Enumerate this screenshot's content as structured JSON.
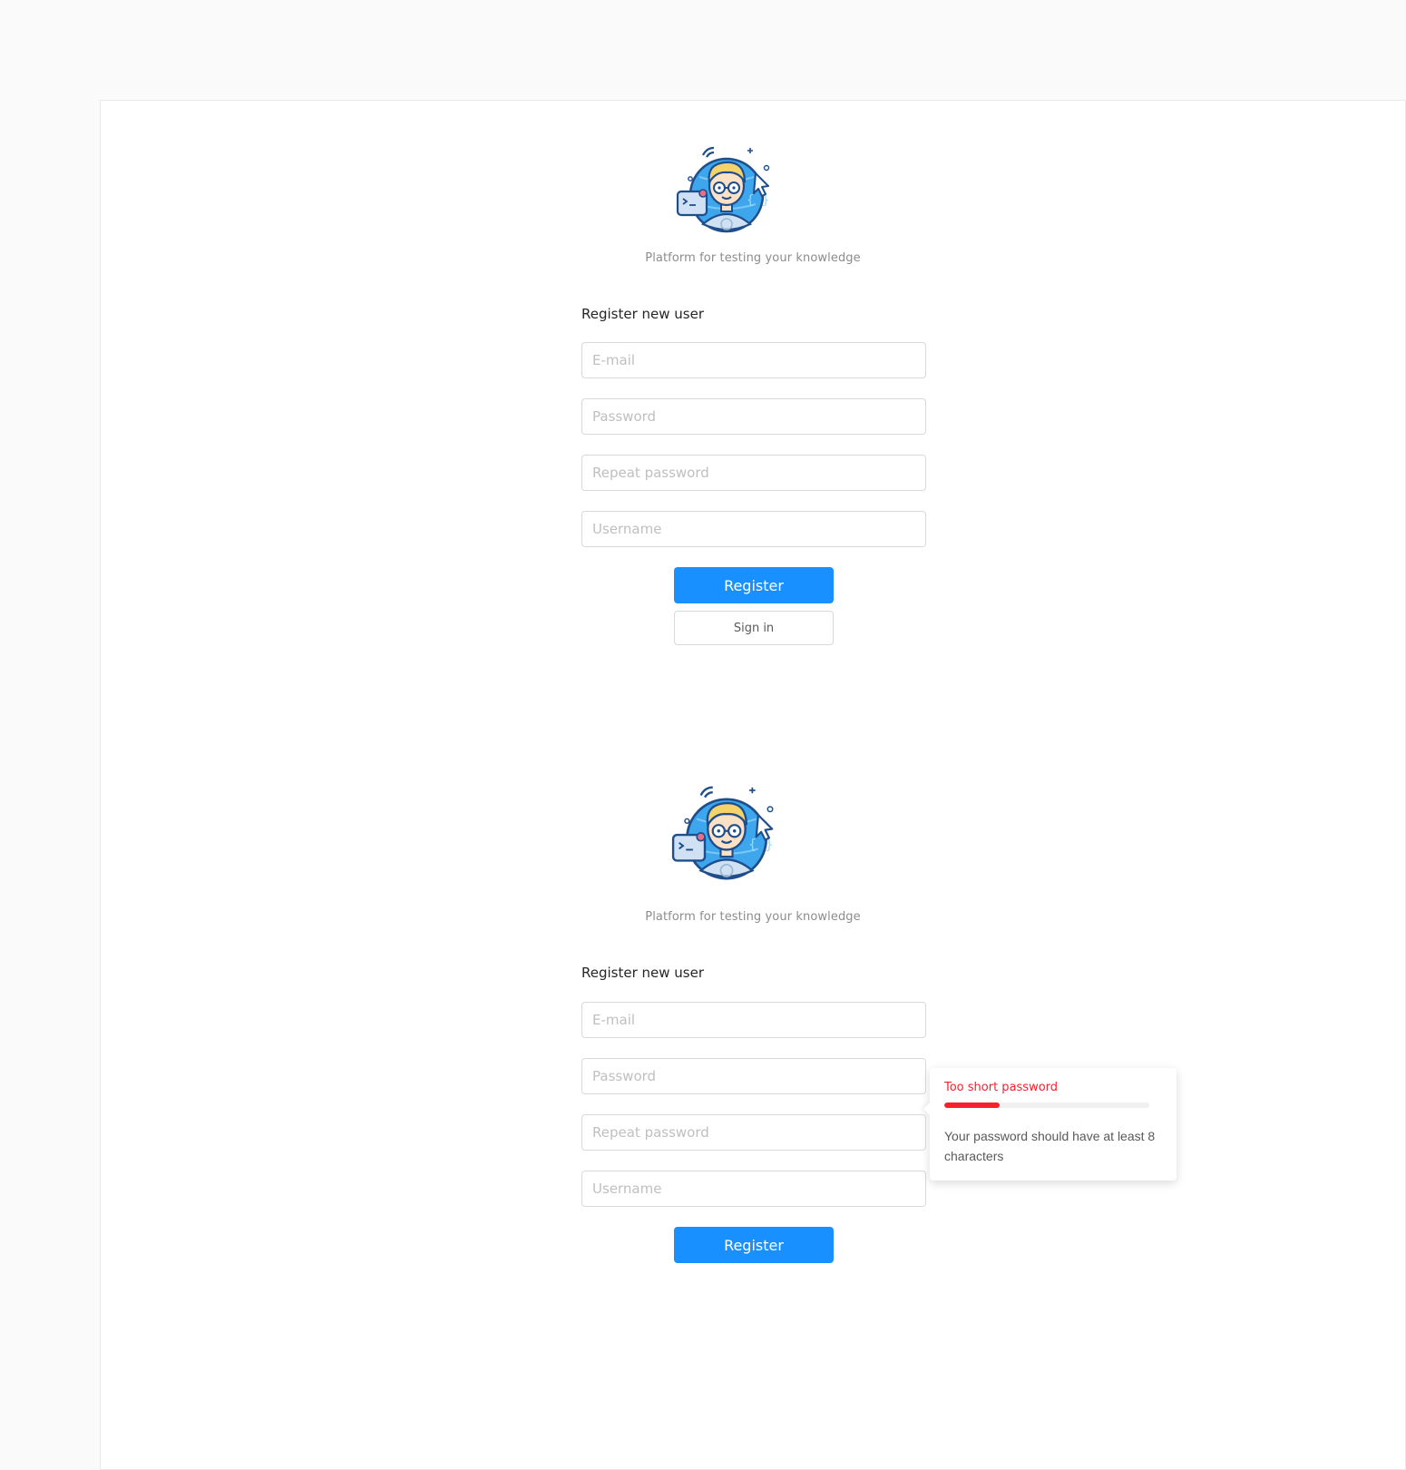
{
  "top_form": {
    "tagline": "Platform for testing your knowledge",
    "title": "Register new user",
    "email_placeholder": "E-mail",
    "password_placeholder": "Password",
    "repeat_password_placeholder": "Repeat password",
    "username_placeholder": "Username",
    "register_label": "Register",
    "signin_label": "Sign in"
  },
  "bottom_form": {
    "tagline": "Platform for testing your knowledge",
    "title": "Register new user",
    "email_placeholder": "E-mail",
    "password_placeholder": "Password",
    "repeat_password_placeholder": "Repeat password",
    "username_placeholder": "Username",
    "register_label": "Register"
  },
  "password_popover": {
    "title": "Too short password",
    "strength_fraction": 0.27,
    "message": "Your password should have at least 8 characters"
  },
  "colors": {
    "primary": "#1890ff",
    "error": "#f5222d",
    "avatar_blue": "#2f8fd8",
    "hair": "#f5d36b"
  },
  "icons": {
    "avatar": "developer-avatar-icon"
  }
}
